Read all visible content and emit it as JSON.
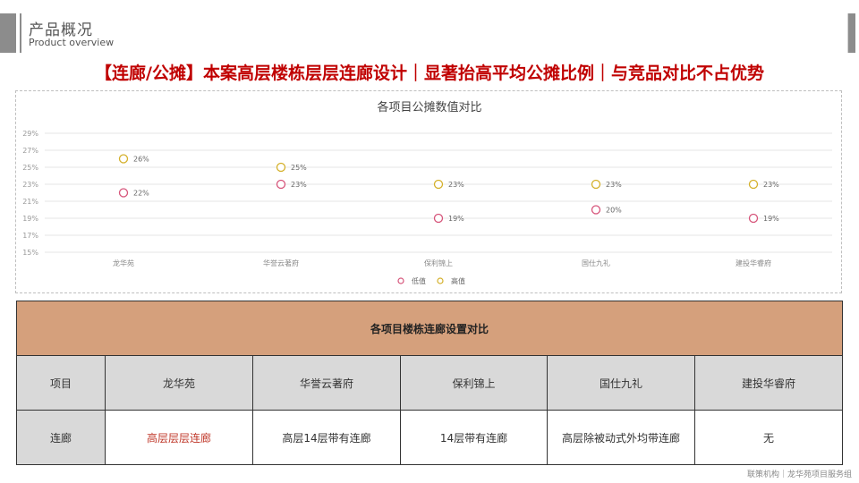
{
  "header": {
    "title_zh": "产品概况",
    "title_en": "Product overview"
  },
  "headline": "【连廊/公摊】本案高层楼栋层层连廊设计｜显著抬高平均公摊比例｜与竞品对比不占优势",
  "chart_data": {
    "type": "scatter",
    "title": "各项目公摊数值对比",
    "categories": [
      "龙华苑",
      "华誉云著府",
      "保利锦上",
      "国仕九礼",
      "建投华睿府"
    ],
    "series": [
      {
        "name": "低值",
        "color": "#d6547a",
        "values": [
          22,
          23,
          19,
          20,
          19
        ]
      },
      {
        "name": "高值",
        "color": "#d4b02a",
        "values": [
          26,
          25,
          23,
          23,
          23
        ]
      }
    ],
    "ylim": [
      15,
      29
    ],
    "yticks": [
      "15%",
      "17%",
      "19%",
      "21%",
      "23%",
      "25%",
      "27%",
      "29%"
    ],
    "grid": true,
    "legend_position": "bottom"
  },
  "table": {
    "title": "各项目楼栋连廊设置对比",
    "header_label": "项目",
    "projects": [
      "龙华苑",
      "华誉云著府",
      "保利锦上",
      "国仕九礼",
      "建投华睿府"
    ],
    "row_label": "连廊",
    "values": [
      "高层层层连廊",
      "高层14层带有连廊",
      "14层带有连廊",
      "高层除被动式外均带连廊",
      "无"
    ]
  },
  "footer": "联策机构｜龙华苑项目服务组"
}
